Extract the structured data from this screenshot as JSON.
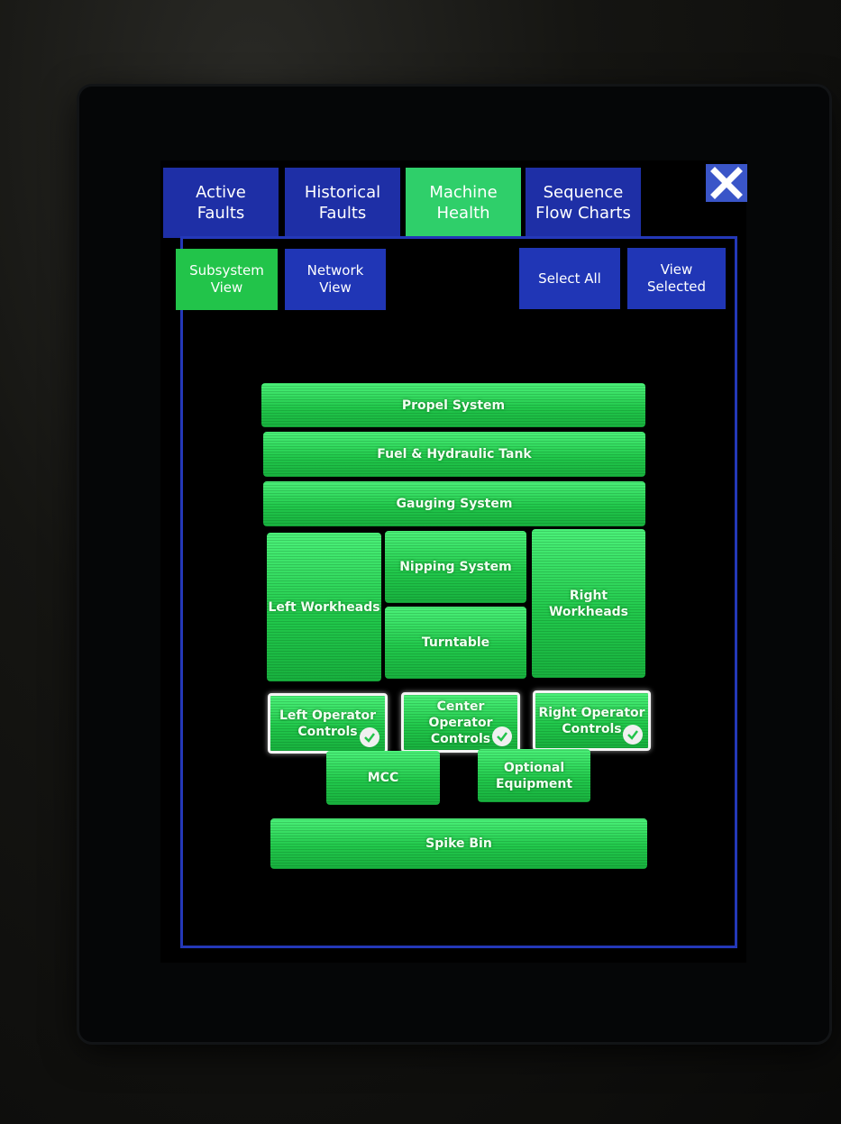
{
  "tabs": [
    {
      "label": "Active\nFaults"
    },
    {
      "label": "Historical\nFaults"
    },
    {
      "label": "Machine\nHealth"
    },
    {
      "label": "Sequence\nFlow Charts"
    }
  ],
  "active_tab": "Machine\nHealth",
  "view_buttons": {
    "subsystem": "Subsystem\nView",
    "network": "Network\nView",
    "select_all": "Select All",
    "view_selected": "View\nSelected"
  },
  "subsystems": {
    "propel": "Propel System",
    "fuel": "Fuel & Hydraulic Tank",
    "gauging": "Gauging System",
    "left_workheads": "Left Workheads",
    "nipping": "Nipping System",
    "turntable": "Turntable",
    "right_workheads": "Right\nWorkheads",
    "left_operator": "Left Operator\nControls",
    "center_operator": "Center\nOperator\nControls",
    "right_operator": "Right Operator\nControls",
    "mcc": "MCC",
    "optional": "Optional\nEquipment",
    "spike_bin": "Spike Bin"
  },
  "colors": {
    "tab_blue": "#1e2fa6",
    "active_green": "#2fcf6a",
    "subsystem_green": "#22c94c",
    "frame_blue": "#2438b8"
  }
}
